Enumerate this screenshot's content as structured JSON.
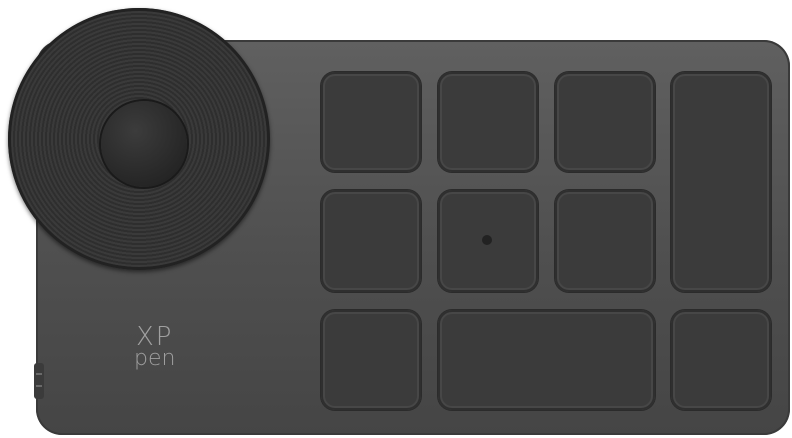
{
  "logo": {
    "line1": "XP",
    "line2": "pen"
  },
  "colors": {
    "body": "#555555",
    "keys": "#3b3b3b",
    "dial": "#2e2e2e",
    "logo": "#a0a0a0"
  },
  "keys": [
    {
      "id": "key-1"
    },
    {
      "id": "key-2"
    },
    {
      "id": "key-3"
    },
    {
      "id": "key-4-tall"
    },
    {
      "id": "key-5"
    },
    {
      "id": "key-6-dot"
    },
    {
      "id": "key-7"
    },
    {
      "id": "key-8"
    },
    {
      "id": "key-9-wide"
    },
    {
      "id": "key-10"
    }
  ]
}
